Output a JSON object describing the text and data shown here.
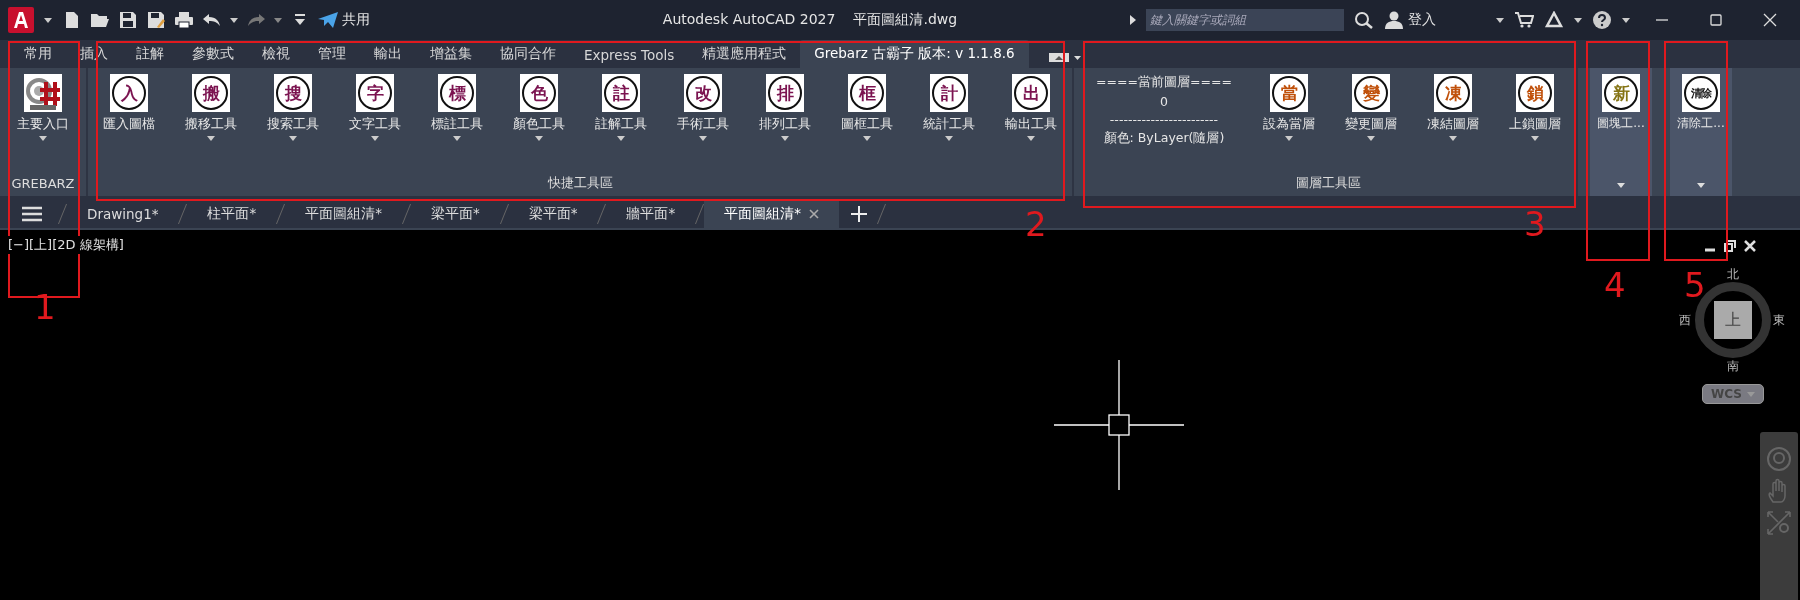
{
  "title_bar": {
    "app_title": "Autodesk AutoCAD 2027",
    "file_name": "平面圖組清.dwg",
    "share_label": "共用",
    "search": {
      "placeholder": "鍵入關鍵字或詞組"
    },
    "sign_in": "登入"
  },
  "ribbon_tabs": [
    {
      "label": "常用",
      "selected": false
    },
    {
      "label": "插入",
      "selected": false
    },
    {
      "label": "註解",
      "selected": false
    },
    {
      "label": "參數式",
      "selected": false
    },
    {
      "label": "檢視",
      "selected": false
    },
    {
      "label": "管理",
      "selected": false
    },
    {
      "label": "輸出",
      "selected": false
    },
    {
      "label": "增益集",
      "selected": false
    },
    {
      "label": "協同合作",
      "selected": false
    },
    {
      "label": "Express Tools",
      "selected": false
    },
    {
      "label": "精選應用程式",
      "selected": false
    },
    {
      "label": "Grebarz 古霸子 版本: v 1.1.8.6",
      "selected": true
    }
  ],
  "ribbon_panels": [
    {
      "kind": "tools",
      "title": "GREBARZ",
      "buttons": [
        {
          "kind": "logo",
          "label": "主要入口",
          "dropdown": true
        }
      ]
    },
    {
      "kind": "tools",
      "title": "快捷工具區",
      "buttons": [
        {
          "kind": "char",
          "icon_char": "入",
          "color": "#7b1350",
          "label": "匯入圖檔",
          "dropdown": false
        },
        {
          "kind": "char",
          "icon_char": "搬",
          "color": "#7b1350",
          "label": "搬移工具",
          "dropdown": true
        },
        {
          "kind": "char",
          "icon_char": "搜",
          "color": "#7b1350",
          "label": "搜索工具",
          "dropdown": true
        },
        {
          "kind": "char",
          "icon_char": "字",
          "color": "#7b1350",
          "label": "文字工具",
          "dropdown": true
        },
        {
          "kind": "char",
          "icon_char": "標",
          "color": "#7b1350",
          "label": "標註工具",
          "dropdown": true
        },
        {
          "kind": "char",
          "icon_char": "色",
          "color": "#7b1350",
          "label": "顏色工具",
          "dropdown": true
        },
        {
          "kind": "char",
          "icon_char": "註",
          "color": "#7b1350",
          "label": "註解工具",
          "dropdown": true
        },
        {
          "kind": "char",
          "icon_char": "改",
          "color": "#7b1350",
          "label": "手術工具",
          "dropdown": true
        },
        {
          "kind": "char",
          "icon_char": "排",
          "color": "#7b1350",
          "label": "排列工具",
          "dropdown": true
        },
        {
          "kind": "char",
          "icon_char": "框",
          "color": "#7b1350",
          "label": "圖框工具",
          "dropdown": true
        },
        {
          "kind": "char",
          "icon_char": "計",
          "color": "#7b1350",
          "label": "統計工具",
          "dropdown": true
        },
        {
          "kind": "char",
          "icon_char": "出",
          "color": "#7b1350",
          "label": "輸出工具",
          "dropdown": true
        }
      ]
    },
    {
      "kind": "layers",
      "title": "圖層工具區",
      "current_layer_heading": "====當前圖層====",
      "current_layer": "0",
      "divider": "------------------------",
      "color_line": "顏色: ByLayer(隨層)",
      "buttons": [
        {
          "kind": "char",
          "icon_char": "當",
          "color": "#c0500a",
          "label": "設為當層",
          "dropdown": true
        },
        {
          "kind": "char",
          "icon_char": "變",
          "color": "#c0500a",
          "label": "變更圖層",
          "dropdown": true
        },
        {
          "kind": "char",
          "icon_char": "凍",
          "color": "#c0500a",
          "label": "凍結圖層",
          "dropdown": true
        },
        {
          "kind": "char",
          "icon_char": "鎖",
          "color": "#c0500a",
          "label": "上鎖圖層",
          "dropdown": true
        }
      ]
    },
    {
      "kind": "slideout",
      "buttons": [
        {
          "kind": "char",
          "icon_char": "新",
          "color": "#857414",
          "label": "圖塊工...",
          "dropdown": true
        }
      ]
    },
    {
      "kind": "slideout",
      "buttons": [
        {
          "kind": "char",
          "icon_char": "清除",
          "color": "#111111",
          "label": "清除工...",
          "dropdown": true
        }
      ]
    }
  ],
  "doc_tabs": [
    {
      "label": "Drawing1*",
      "selected": false
    },
    {
      "label": "柱平面*",
      "selected": false
    },
    {
      "label": "平面圖組清*",
      "selected": false
    },
    {
      "label": "梁平面*",
      "selected": false
    },
    {
      "label": "梁平面*",
      "selected": false
    },
    {
      "label": "牆平面*",
      "selected": false
    },
    {
      "label": "平面圖組清*",
      "selected": true
    }
  ],
  "viewport": {
    "label": "[−][上][2D 線架構]",
    "viewcube": {
      "north": "北",
      "south": "南",
      "east": "東",
      "west": "西",
      "face": "上"
    },
    "ucs": "WCS"
  },
  "annotations": [
    {
      "label": "1"
    },
    {
      "label": "2"
    },
    {
      "label": "3"
    },
    {
      "label": "4"
    },
    {
      "label": "5"
    }
  ]
}
